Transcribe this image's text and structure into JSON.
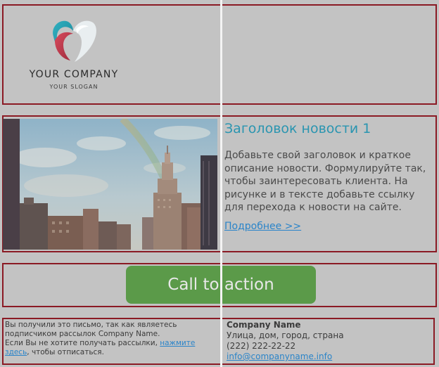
{
  "header": {
    "logo_name": "YOUR COMPANY",
    "logo_slogan": "YOUR SLOGAN"
  },
  "news": {
    "title": "Заголовок новости 1",
    "text": "Добавьте свой заголовок и краткое описание новости. Формулируйте так, чтобы заинтересовать клиента. На рисунке и в тексте добавьте ссылку для перехода к новости на сайте.",
    "more_link": "Подробнее >>"
  },
  "cta": {
    "label": "Call to action"
  },
  "footer": {
    "notice_part1": "Вы получили это письмо, так как являетесь подписчиком рассылок Company Name.",
    "notice_part2": "Если Вы не хотите получать рассылки, ",
    "unsubscribe_link": "нажмите здесь",
    "notice_part3": ", чтобы отписаться.",
    "company_name": "Company Name",
    "address": "Улица, дом, город, страна",
    "phone": "(222) 222-22-22",
    "email": "info@companyname.info"
  },
  "colors": {
    "background": "#c3c3c3",
    "block_border": "#8b1a24",
    "title": "#2a95b0",
    "link": "#2a84c9",
    "cta_background": "#5b9a49",
    "cta_text": "#e8e8e8"
  }
}
